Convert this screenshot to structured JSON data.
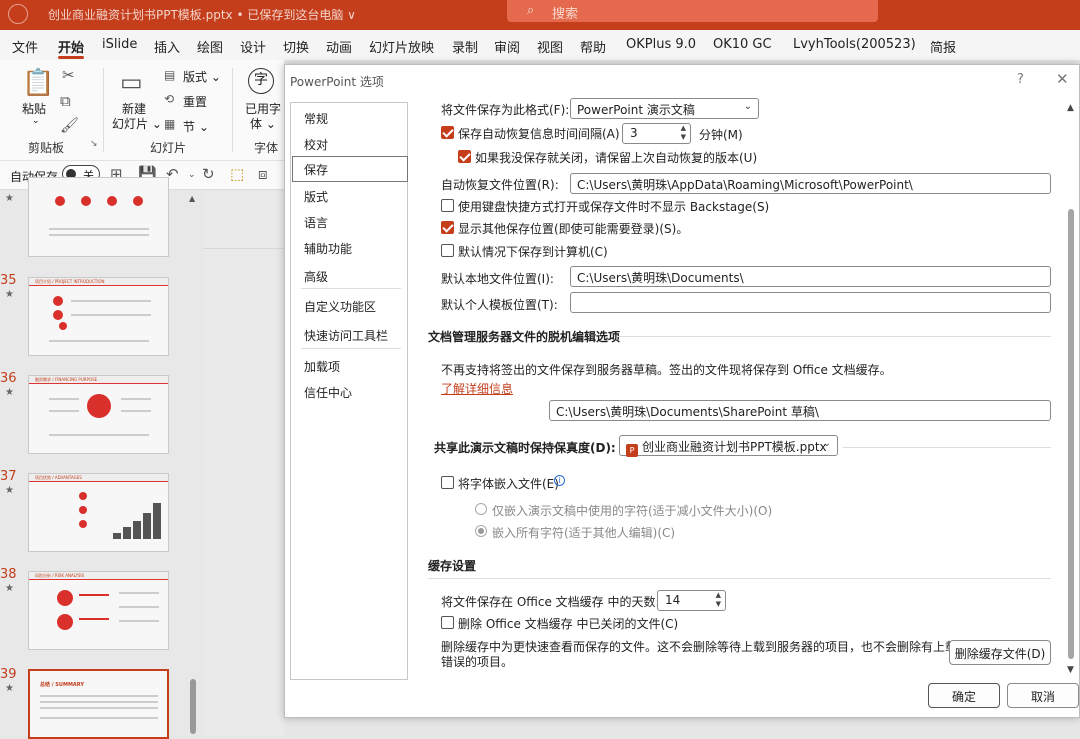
{
  "titlebar": {
    "doc_title": "创业商业融资计划书PPT模板.pptx • 已保存到这台电脑 ∨",
    "search_placeholder": "搜索"
  },
  "menu": [
    "文件",
    "开始",
    "iSlide",
    "插入",
    "绘图",
    "设计",
    "切换",
    "动画",
    "幻灯片放映",
    "录制",
    "审阅",
    "视图",
    "帮助",
    "OKPlus 9.0",
    "OK10 GC",
    "LvyhTools(200523)",
    "简报"
  ],
  "ribbon": {
    "paste": "粘贴",
    "clipboard": "剪贴板",
    "new_slide": "新建",
    "new_slide2": "幻灯片 ⌄",
    "layout": "版式 ⌄",
    "reset": "重置",
    "section": "节 ⌄",
    "slides_group": "幻灯片",
    "used_font": "已用字",
    "used_font2": "体 ⌄",
    "font_group": "字体"
  },
  "qat": {
    "autosave": "自动保存",
    "toggle": "关"
  },
  "slides": [
    {
      "num": "",
      "label": ""
    },
    {
      "num": "35",
      "label": "项目介绍 / PROJECT INTRODUCTION"
    },
    {
      "num": "36",
      "label": "融资需求 / FINANCING PURPOSE"
    },
    {
      "num": "37",
      "label": "项目优势 / ADVANTAGES"
    },
    {
      "num": "38",
      "label": "风险分析 / RISK ANALYSIS"
    },
    {
      "num": "39",
      "label": "总结 / SUMMARY"
    }
  ],
  "dialog": {
    "title": "PowerPoint 选项",
    "help": "?",
    "close": "✕",
    "nav": [
      "常规",
      "校对",
      "保存",
      "版式",
      "语言",
      "辅助功能",
      "高级",
      "自定义功能区",
      "快速访问工具栏",
      "加载项",
      "信任中心"
    ],
    "save_format_label": "将文件保存为此格式(F):",
    "save_format_value": "PowerPoint 演示文稿",
    "autorecover_label": "保存自动恢复信息时间间隔(A)",
    "autorecover_minutes": "3",
    "minutes_label": "分钟(M)",
    "keep_last_label": "如果我没保存就关闭，请保留上次自动恢复的版本(U)",
    "autorecover_path_label": "自动恢复文件位置(R):",
    "autorecover_path": "C:\\Users\\黄明珠\\AppData\\Roaming\\Microsoft\\PowerPoint\\",
    "no_backstage_label": "使用键盘快捷方式打开或保存文件时不显示 Backstage(S)",
    "show_other_label": "显示其他保存位置(即使可能需要登录)(S)。",
    "save_to_computer_label": "默认情况下保存到计算机(C)",
    "local_path_label": "默认本地文件位置(I):",
    "local_path": "C:\\Users\\黄明珠\\Documents\\",
    "template_path_label": "默认个人模板位置(T):",
    "template_path": "",
    "offline_heading": "文档管理服务器文件的脱机编辑选项",
    "offline_note": "不再支持将签出的文件保存到服务器草稿。签出的文件现将保存到 Office 文档缓存。",
    "learn_more": "了解详细信息",
    "drafts_label": "服务器草稿位置(V):",
    "drafts_path": "C:\\Users\\黄明珠\\Documents\\SharePoint 草稿\\",
    "fidelity_label": "共享此演示文稿时保持保真度(D):",
    "fidelity_file": "创业商业融资计划书PPT模板.pptx",
    "embed_fonts_label": "将字体嵌入文件(E)",
    "embed_used_label": "仅嵌入演示文稿中使用的字符(适于减小文件大小)(O)",
    "embed_all_label": "嵌入所有字符(适于其他人编辑)(C)",
    "cache_heading": "缓存设置",
    "cache_days_label": "将文件保存在 Office 文档缓存 中的天数:",
    "cache_days": "14",
    "delete_closed_label": "删除 Office 文档缓存 中已关闭的文件(C)",
    "cache_note_1": "删除缓存中为更快速查看而保存的文件。这不会删除等待上载到服务器的项目，也不会删除有上载",
    "cache_note_2": "错误的项目。",
    "delete_cache_button": "删除缓存文件(D)",
    "ok": "确定",
    "cancel": "取消"
  },
  "colors": {
    "accent": "#c43e1c"
  }
}
